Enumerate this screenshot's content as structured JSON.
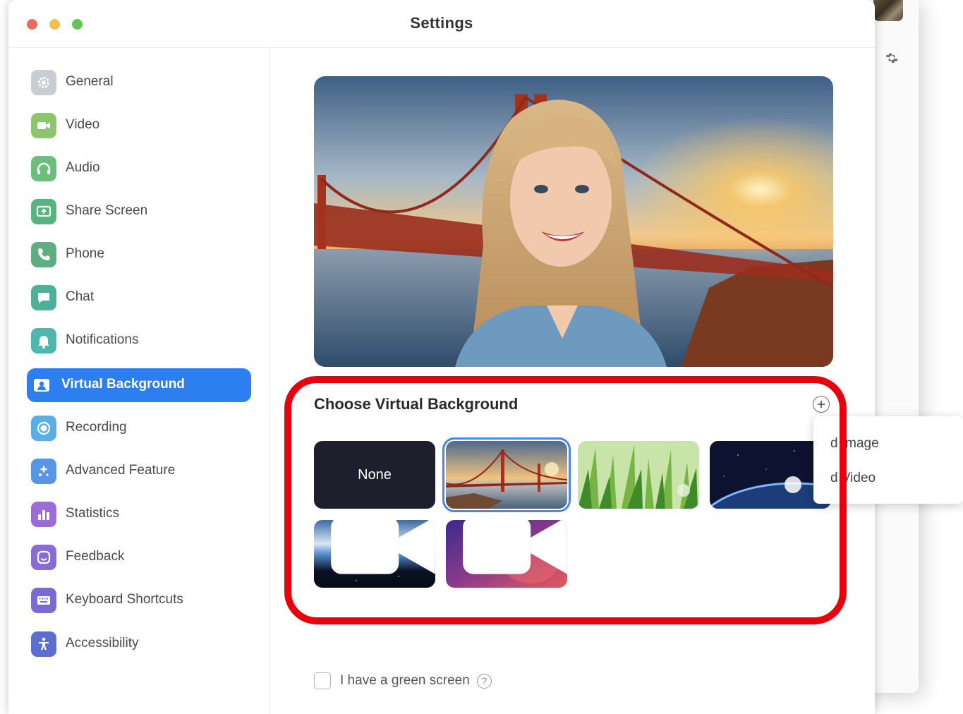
{
  "window": {
    "title": "Settings"
  },
  "sidebar": {
    "items": [
      {
        "label": "General",
        "icon": "gear-icon",
        "color": "#c8cdd4",
        "active": false
      },
      {
        "label": "Video",
        "icon": "video-camera-icon",
        "color": "#8dc56c",
        "active": false
      },
      {
        "label": "Audio",
        "icon": "headphones-icon",
        "color": "#6abf7a",
        "active": false
      },
      {
        "label": "Share Screen",
        "icon": "share-screen-icon",
        "color": "#56b57e",
        "active": false
      },
      {
        "label": "Phone",
        "icon": "phone-icon",
        "color": "#5fae82",
        "active": false
      },
      {
        "label": "Chat",
        "icon": "chat-icon",
        "color": "#4fb09a",
        "active": false
      },
      {
        "label": "Notifications",
        "icon": "bell-icon",
        "color": "#4fb6ad",
        "active": false
      },
      {
        "label": "Virtual Background",
        "icon": "person-frame-icon",
        "color": "#2d7ff0",
        "active": true
      },
      {
        "label": "Recording",
        "icon": "record-icon",
        "color": "#5aaee8",
        "active": false
      },
      {
        "label": "Advanced Feature",
        "icon": "sparkle-icon",
        "color": "#5a94e6",
        "active": false
      },
      {
        "label": "Statistics",
        "icon": "bar-chart-icon",
        "color": "#9b6cd8",
        "active": false
      },
      {
        "label": "Feedback",
        "icon": "smiley-icon",
        "color": "#8a6bd6",
        "active": false
      },
      {
        "label": "Keyboard Shortcuts",
        "icon": "keyboard-icon",
        "color": "#7a6ad4",
        "active": false
      },
      {
        "label": "Accessibility",
        "icon": "accessibility-icon",
        "color": "#5b6fd0",
        "active": false
      }
    ]
  },
  "main": {
    "section_title": "Choose Virtual Background",
    "backgrounds": [
      {
        "label": "None",
        "kind": "none",
        "selected": false
      },
      {
        "label": "",
        "kind": "golden-gate-bridge",
        "selected": true
      },
      {
        "label": "",
        "kind": "grass",
        "selected": false
      },
      {
        "label": "",
        "kind": "earth-from-space",
        "selected": false
      },
      {
        "label": "",
        "kind": "earth-horizon-video",
        "selected": false
      },
      {
        "label": "",
        "kind": "purple-gradient-video",
        "selected": false
      }
    ],
    "add_menu": {
      "items": [
        "d Image",
        "d Video"
      ]
    },
    "green_screen": {
      "label": "I have a green screen",
      "checked": false,
      "help": "?"
    }
  },
  "colors": {
    "accent": "#2d7ff0",
    "highlight": "#e8000c",
    "selection": "#4a86e8"
  }
}
